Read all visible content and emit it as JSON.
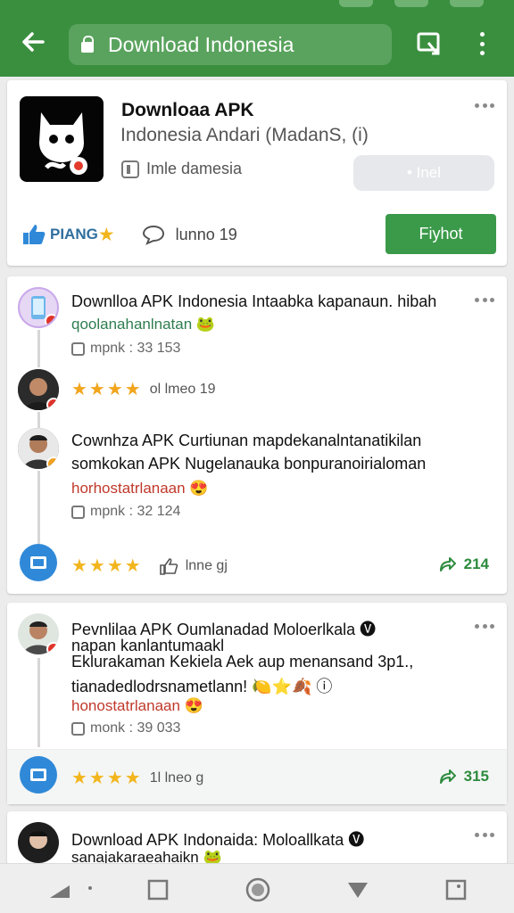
{
  "browser": {
    "url": "Download Indonesia"
  },
  "app_card": {
    "title": "Downloaa APK",
    "subtitle": "Indonesia Andari (MadanS, (i)",
    "meta": "Imle damesia",
    "install_label": "• Inel",
    "rating_label": "PIANG",
    "comments": "lunno 19",
    "open_label": "Fiyhot"
  },
  "reviews": [
    {
      "title": "Downlloa APK Indonesia Intaabka kapanaun. hibah",
      "tag": "qoolanahanlnatan 🐸",
      "views": "mpnk : 33 153"
    },
    {
      "stars_text": "ol lmeo 19"
    },
    {
      "title_line1": "Cownhza APK Curtiunan mapdekanalntanatikilan",
      "title_line2": "somkokan APK Nugelanauka bonpuranoirialoman",
      "tag": "horhostatrlanaan 😍",
      "views": "mpnk : 32 124",
      "stars_text": "lnne gj",
      "shares": "214"
    },
    {
      "title_line1": "Pevnlilaa APK Oumlanadad Moloerlkala 🅥",
      "title_line2": "napan kanlantumaakl",
      "title_line3": "Eklurakaman Kekiela Aek aup menansand 3p1.,",
      "title_line4": "tianadedlodrsnametlann! 🍋⭐🍂 ⓘ",
      "tag": "honostatrlanaan 😍",
      "views": "monk : 39 033",
      "stars_text": "1l lneo g",
      "shares": "315"
    },
    {
      "title": "Download APK Indonaida: Moloallkata 🅥",
      "tag": "sanajakaraeahaikn 🐸"
    }
  ],
  "colors": {
    "appbar": "#3a8f3f",
    "accent_green": "#3a9a49",
    "star": "#f2b51d",
    "tag_red": "#c0392b",
    "link_blue": "#2f89d8"
  },
  "icons": [
    "back-arrow-icon",
    "lock-icon",
    "tab-switcher-icon",
    "more-vert-icon",
    "thumbs-up-icon",
    "star-icon",
    "comment-icon",
    "share-icon",
    "nav-back-icon",
    "nav-home-icon",
    "nav-recents-icon"
  ]
}
